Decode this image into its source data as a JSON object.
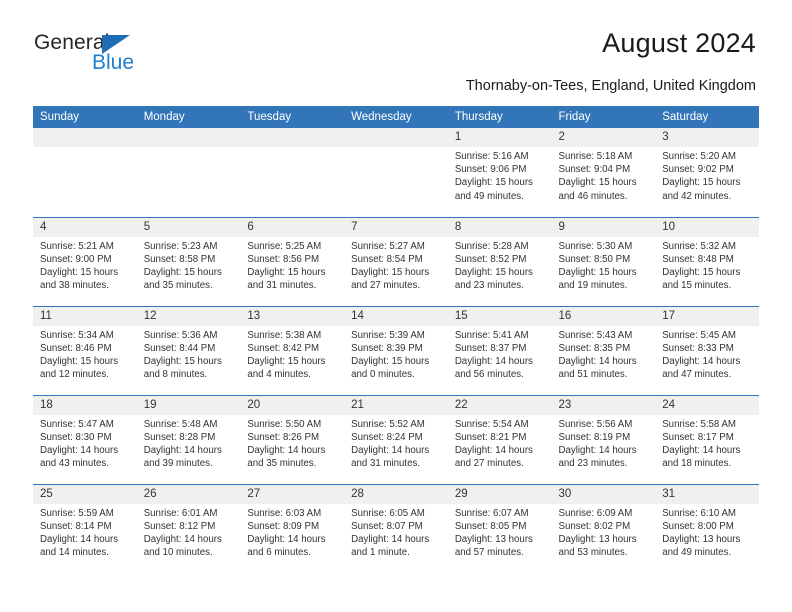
{
  "brand": {
    "name_top": "General",
    "name_bottom": "Blue",
    "accent_color": "#1f7fd0",
    "triangle_color": "#1f6db4"
  },
  "header": {
    "title": "August 2024",
    "subtitle": "Thornaby-on-Tees, England, United Kingdom"
  },
  "calendar": {
    "header_bg": "#3275b8",
    "daycell_header_bg": "#f0f0f0",
    "weekday_headers": [
      "Sunday",
      "Monday",
      "Tuesday",
      "Wednesday",
      "Thursday",
      "Friday",
      "Saturday"
    ],
    "weeks": [
      [
        {
          "day": "",
          "lines": []
        },
        {
          "day": "",
          "lines": []
        },
        {
          "day": "",
          "lines": []
        },
        {
          "day": "",
          "lines": []
        },
        {
          "day": "1",
          "lines": [
            "Sunrise: 5:16 AM",
            "Sunset: 9:06 PM",
            "Daylight: 15 hours",
            "and 49 minutes."
          ]
        },
        {
          "day": "2",
          "lines": [
            "Sunrise: 5:18 AM",
            "Sunset: 9:04 PM",
            "Daylight: 15 hours",
            "and 46 minutes."
          ]
        },
        {
          "day": "3",
          "lines": [
            "Sunrise: 5:20 AM",
            "Sunset: 9:02 PM",
            "Daylight: 15 hours",
            "and 42 minutes."
          ]
        }
      ],
      [
        {
          "day": "4",
          "lines": [
            "Sunrise: 5:21 AM",
            "Sunset: 9:00 PM",
            "Daylight: 15 hours",
            "and 38 minutes."
          ]
        },
        {
          "day": "5",
          "lines": [
            "Sunrise: 5:23 AM",
            "Sunset: 8:58 PM",
            "Daylight: 15 hours",
            "and 35 minutes."
          ]
        },
        {
          "day": "6",
          "lines": [
            "Sunrise: 5:25 AM",
            "Sunset: 8:56 PM",
            "Daylight: 15 hours",
            "and 31 minutes."
          ]
        },
        {
          "day": "7",
          "lines": [
            "Sunrise: 5:27 AM",
            "Sunset: 8:54 PM",
            "Daylight: 15 hours",
            "and 27 minutes."
          ]
        },
        {
          "day": "8",
          "lines": [
            "Sunrise: 5:28 AM",
            "Sunset: 8:52 PM",
            "Daylight: 15 hours",
            "and 23 minutes."
          ]
        },
        {
          "day": "9",
          "lines": [
            "Sunrise: 5:30 AM",
            "Sunset: 8:50 PM",
            "Daylight: 15 hours",
            "and 19 minutes."
          ]
        },
        {
          "day": "10",
          "lines": [
            "Sunrise: 5:32 AM",
            "Sunset: 8:48 PM",
            "Daylight: 15 hours",
            "and 15 minutes."
          ]
        }
      ],
      [
        {
          "day": "11",
          "lines": [
            "Sunrise: 5:34 AM",
            "Sunset: 8:46 PM",
            "Daylight: 15 hours",
            "and 12 minutes."
          ]
        },
        {
          "day": "12",
          "lines": [
            "Sunrise: 5:36 AM",
            "Sunset: 8:44 PM",
            "Daylight: 15 hours",
            "and 8 minutes."
          ]
        },
        {
          "day": "13",
          "lines": [
            "Sunrise: 5:38 AM",
            "Sunset: 8:42 PM",
            "Daylight: 15 hours",
            "and 4 minutes."
          ]
        },
        {
          "day": "14",
          "lines": [
            "Sunrise: 5:39 AM",
            "Sunset: 8:39 PM",
            "Daylight: 15 hours",
            "and 0 minutes."
          ]
        },
        {
          "day": "15",
          "lines": [
            "Sunrise: 5:41 AM",
            "Sunset: 8:37 PM",
            "Daylight: 14 hours",
            "and 56 minutes."
          ]
        },
        {
          "day": "16",
          "lines": [
            "Sunrise: 5:43 AM",
            "Sunset: 8:35 PM",
            "Daylight: 14 hours",
            "and 51 minutes."
          ]
        },
        {
          "day": "17",
          "lines": [
            "Sunrise: 5:45 AM",
            "Sunset: 8:33 PM",
            "Daylight: 14 hours",
            "and 47 minutes."
          ]
        }
      ],
      [
        {
          "day": "18",
          "lines": [
            "Sunrise: 5:47 AM",
            "Sunset: 8:30 PM",
            "Daylight: 14 hours",
            "and 43 minutes."
          ]
        },
        {
          "day": "19",
          "lines": [
            "Sunrise: 5:48 AM",
            "Sunset: 8:28 PM",
            "Daylight: 14 hours",
            "and 39 minutes."
          ]
        },
        {
          "day": "20",
          "lines": [
            "Sunrise: 5:50 AM",
            "Sunset: 8:26 PM",
            "Daylight: 14 hours",
            "and 35 minutes."
          ]
        },
        {
          "day": "21",
          "lines": [
            "Sunrise: 5:52 AM",
            "Sunset: 8:24 PM",
            "Daylight: 14 hours",
            "and 31 minutes."
          ]
        },
        {
          "day": "22",
          "lines": [
            "Sunrise: 5:54 AM",
            "Sunset: 8:21 PM",
            "Daylight: 14 hours",
            "and 27 minutes."
          ]
        },
        {
          "day": "23",
          "lines": [
            "Sunrise: 5:56 AM",
            "Sunset: 8:19 PM",
            "Daylight: 14 hours",
            "and 23 minutes."
          ]
        },
        {
          "day": "24",
          "lines": [
            "Sunrise: 5:58 AM",
            "Sunset: 8:17 PM",
            "Daylight: 14 hours",
            "and 18 minutes."
          ]
        }
      ],
      [
        {
          "day": "25",
          "lines": [
            "Sunrise: 5:59 AM",
            "Sunset: 8:14 PM",
            "Daylight: 14 hours",
            "and 14 minutes."
          ]
        },
        {
          "day": "26",
          "lines": [
            "Sunrise: 6:01 AM",
            "Sunset: 8:12 PM",
            "Daylight: 14 hours",
            "and 10 minutes."
          ]
        },
        {
          "day": "27",
          "lines": [
            "Sunrise: 6:03 AM",
            "Sunset: 8:09 PM",
            "Daylight: 14 hours",
            "and 6 minutes."
          ]
        },
        {
          "day": "28",
          "lines": [
            "Sunrise: 6:05 AM",
            "Sunset: 8:07 PM",
            "Daylight: 14 hours",
            "and 1 minute."
          ]
        },
        {
          "day": "29",
          "lines": [
            "Sunrise: 6:07 AM",
            "Sunset: 8:05 PM",
            "Daylight: 13 hours",
            "and 57 minutes."
          ]
        },
        {
          "day": "30",
          "lines": [
            "Sunrise: 6:09 AM",
            "Sunset: 8:02 PM",
            "Daylight: 13 hours",
            "and 53 minutes."
          ]
        },
        {
          "day": "31",
          "lines": [
            "Sunrise: 6:10 AM",
            "Sunset: 8:00 PM",
            "Daylight: 13 hours",
            "and 49 minutes."
          ]
        }
      ]
    ]
  }
}
